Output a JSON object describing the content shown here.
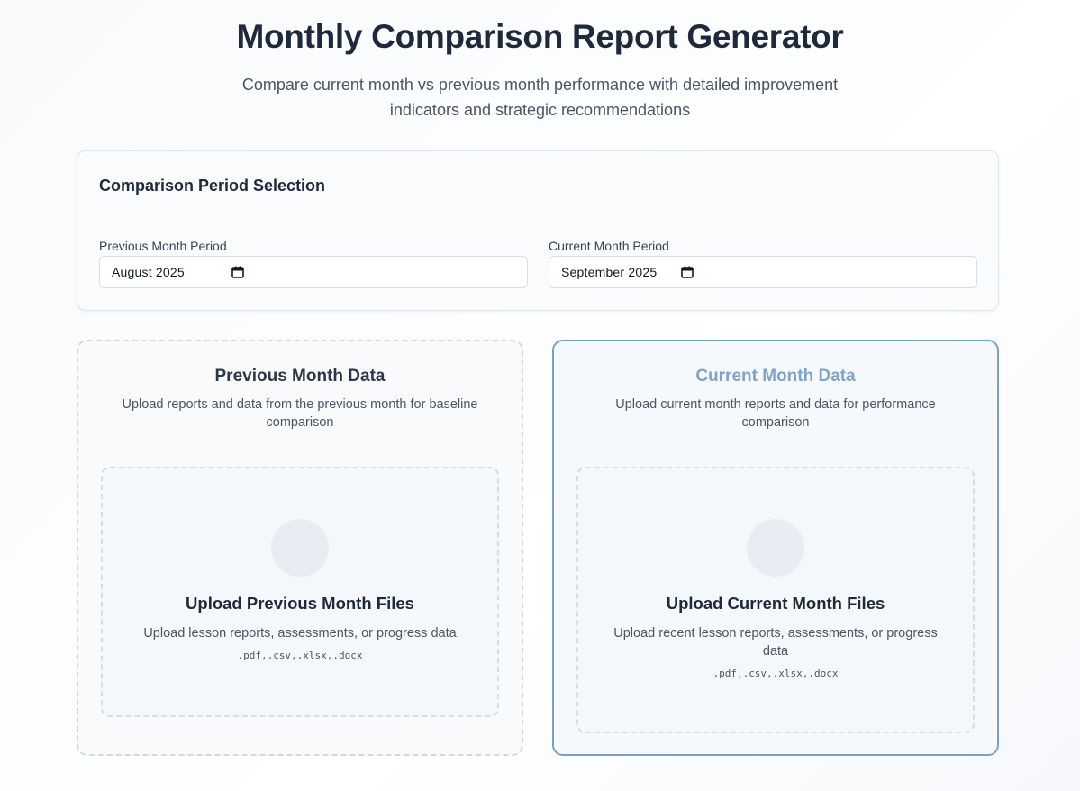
{
  "header": {
    "title": "Monthly Comparison Report Generator",
    "subtitle": "Compare current month vs previous month performance with detailed improvement indicators and strategic recommendations"
  },
  "period_selection": {
    "heading": "Comparison Period Selection",
    "previous": {
      "label": "Previous Month Period",
      "value": "August 2025",
      "icon": "calendar-icon"
    },
    "current": {
      "label": "Current Month Period",
      "value": "September 2025",
      "icon": "calendar-icon"
    }
  },
  "panels": {
    "previous": {
      "title": "Previous Month Data",
      "description": "Upload reports and data from the previous month for baseline comparison",
      "upload_title": "Upload Previous Month Files",
      "upload_description": "Upload lesson reports, assessments, or progress data",
      "file_types": ".pdf,.csv,.xlsx,.docx"
    },
    "current": {
      "title": "Current Month Data",
      "description": "Upload current month reports and data for performance comparison",
      "upload_title": "Upload Current Month Files",
      "upload_description": "Upload recent lesson reports, assessments, or progress data",
      "file_types": ".pdf,.csv,.xlsx,.docx"
    }
  },
  "colors": {
    "title": "#1e293b",
    "active_panel_border": "#7d9fc6",
    "active_panel_title": "#7fa2c8",
    "dashed_border": "#d3d8e0"
  }
}
